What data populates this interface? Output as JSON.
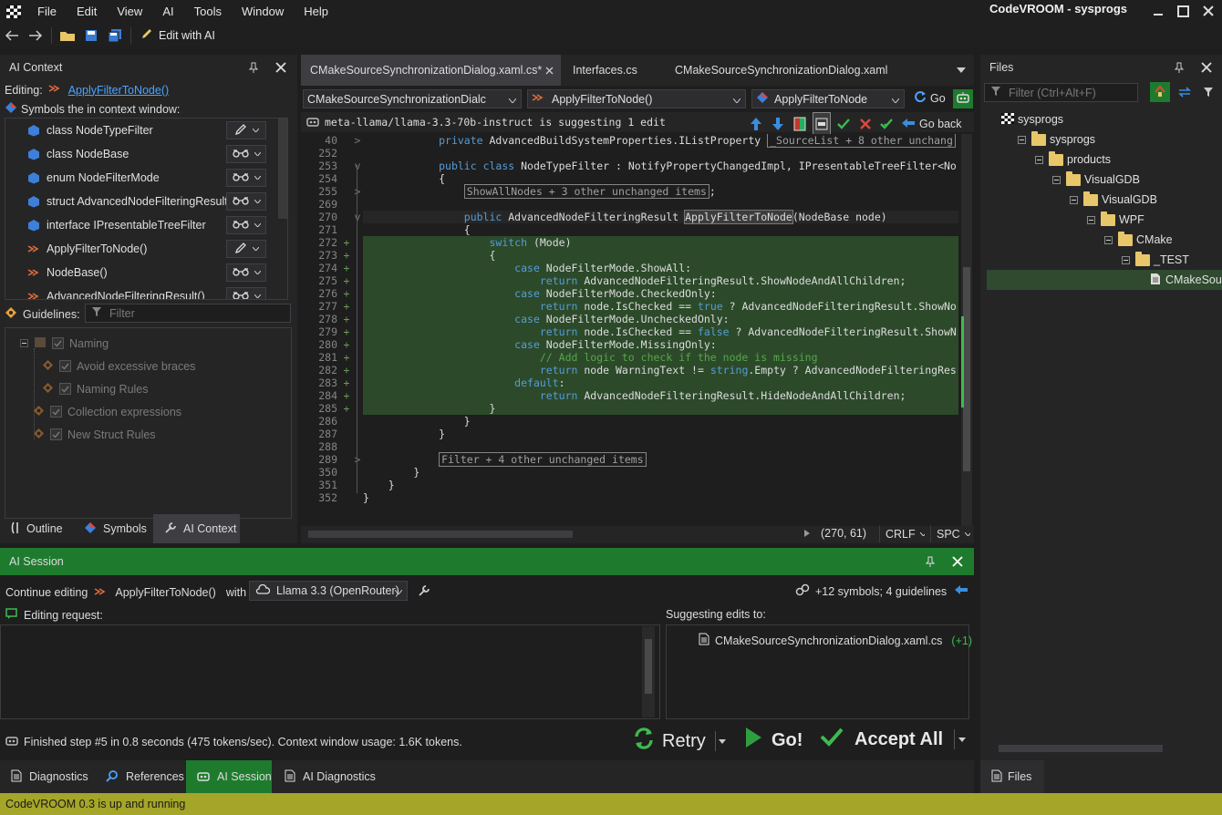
{
  "app": {
    "title": "CodeVROOM - sysprogs"
  },
  "menu": [
    "File",
    "Edit",
    "View",
    "AI",
    "Tools",
    "Window",
    "Help"
  ],
  "toolbar": {
    "edit_with_ai": "Edit with AI"
  },
  "ai_context": {
    "title": "AI Context",
    "editing_label": "Editing:",
    "editing_target": "ApplyFilterToNode()",
    "symbols_caption": "Symbols the in context window:",
    "symbols": [
      {
        "label": "class NodeTypeFilter",
        "mode": "edit-icon"
      },
      {
        "label": "class NodeBase",
        "mode": "glasses-icon"
      },
      {
        "label": "enum NodeFilterMode",
        "mode": "glasses-icon"
      },
      {
        "label": "struct AdvancedNodeFilteringResult",
        "mode": "glasses-icon"
      },
      {
        "label": "interface IPresentableTreeFilter",
        "mode": "glasses-icon"
      },
      {
        "label": "ApplyFilterToNode()",
        "mode": "edit-icon"
      },
      {
        "label": "NodeBase()",
        "mode": "glasses-icon"
      },
      {
        "label": "AdvancedNodeFilteringResult()",
        "mode": "glasses-icon"
      }
    ],
    "guidelines_label": "Guidelines:",
    "guidelines_filter_placeholder": "Filter",
    "guidelines": [
      {
        "label": "Naming",
        "level": 0
      },
      {
        "label": "Avoid excessive braces",
        "level": 1
      },
      {
        "label": "Naming Rules",
        "level": 1
      },
      {
        "label": "Collection expressions",
        "level": 0
      },
      {
        "label": "New Struct Rules",
        "level": 0
      }
    ],
    "tabs": [
      "Outline",
      "Symbols",
      "AI Context"
    ],
    "active_tab": "AI Context"
  },
  "editor": {
    "tabs": [
      {
        "label": "CMakeSourceSynchronizationDialog.xaml.cs*",
        "active": true
      },
      {
        "label": "Interfaces.cs",
        "active": false
      },
      {
        "label": "CMakeSourceSynchronizationDialog.xaml",
        "active": false
      }
    ],
    "nav": {
      "file": "CMakeSourceSynchronizationDialc",
      "member": "ApplyFilterToNode()",
      "symbol": "ApplyFilterToNode",
      "go": "Go"
    },
    "suggestion": {
      "text": "meta-llama/llama-3.3-70b-instruct is suggesting 1 edit",
      "go_back": "Go back"
    },
    "lines": [
      {
        "n": "40",
        "fold": ">",
        "added": false,
        "segs": [
          [
            "            ",
            ""
          ],
          [
            "private",
            "kw"
          ],
          [
            " AdvancedBuildSystemProperties.IListProperty ",
            ""
          ],
          [
            "_SourceList + 8 other unchang",
            "collapsed"
          ]
        ]
      },
      {
        "n": "252",
        "fold": "",
        "added": false,
        "segs": []
      },
      {
        "n": "253",
        "fold": "v",
        "added": false,
        "segs": [
          [
            "            ",
            ""
          ],
          [
            "public",
            "kw"
          ],
          [
            " ",
            ""
          ],
          [
            "class",
            "kw"
          ],
          [
            " NodeTypeFilter : NotifyPropertyChangedImpl, IPresentableTreeFilter<No",
            ""
          ]
        ]
      },
      {
        "n": "254",
        "fold": "",
        "added": false,
        "segs": [
          [
            "            {",
            ""
          ]
        ]
      },
      {
        "n": "255",
        "fold": ">",
        "added": false,
        "segs": [
          [
            "                ",
            ""
          ],
          [
            "ShowAllNodes + 3 other unchanged items",
            "collapsed"
          ],
          [
            ";",
            ""
          ]
        ]
      },
      {
        "n": "269",
        "fold": "",
        "added": false,
        "segs": []
      },
      {
        "n": "270",
        "fold": "v",
        "added": false,
        "segs": [
          [
            "                ",
            ""
          ],
          [
            "public",
            "kw"
          ],
          [
            " AdvancedNodeFilteringResult ",
            ""
          ],
          [
            "ApplyFilterToNode",
            "hl"
          ],
          [
            "(NodeBase node)",
            ""
          ]
        ]
      },
      {
        "n": "271",
        "fold": "",
        "added": false,
        "segs": [
          [
            "                {",
            ""
          ]
        ]
      },
      {
        "n": "272",
        "fold": "",
        "added": true,
        "segs": [
          [
            "                    ",
            ""
          ],
          [
            "switch",
            "kw"
          ],
          [
            " (Mode)",
            ""
          ]
        ]
      },
      {
        "n": "273",
        "fold": "",
        "added": true,
        "segs": [
          [
            "                    {",
            ""
          ]
        ]
      },
      {
        "n": "274",
        "fold": "",
        "added": true,
        "segs": [
          [
            "                        ",
            ""
          ],
          [
            "case",
            "kw"
          ],
          [
            " NodeFilterMode.ShowAll:",
            ""
          ]
        ]
      },
      {
        "n": "275",
        "fold": "",
        "added": true,
        "segs": [
          [
            "                            ",
            ""
          ],
          [
            "return",
            "kw"
          ],
          [
            " AdvancedNodeFilteringResult.ShowNodeAndAllChildren;",
            ""
          ]
        ]
      },
      {
        "n": "276",
        "fold": "",
        "added": true,
        "segs": [
          [
            "                        ",
            ""
          ],
          [
            "case",
            "kw"
          ],
          [
            " NodeFilterMode.CheckedOnly:",
            ""
          ]
        ]
      },
      {
        "n": "277",
        "fold": "",
        "added": true,
        "segs": [
          [
            "                            ",
            ""
          ],
          [
            "return",
            "kw"
          ],
          [
            " node.IsChecked == ",
            ""
          ],
          [
            "true",
            "kw"
          ],
          [
            " ? AdvancedNodeFilteringResult.ShowNo",
            ""
          ]
        ]
      },
      {
        "n": "278",
        "fold": "",
        "added": true,
        "segs": [
          [
            "                        ",
            ""
          ],
          [
            "case",
            "kw"
          ],
          [
            " NodeFilterMode.UncheckedOnly:",
            ""
          ]
        ]
      },
      {
        "n": "279",
        "fold": "",
        "added": true,
        "segs": [
          [
            "                            ",
            ""
          ],
          [
            "return",
            "kw"
          ],
          [
            " node.IsChecked == ",
            ""
          ],
          [
            "false",
            "kw"
          ],
          [
            " ? AdvancedNodeFilteringResult.ShowN",
            ""
          ]
        ]
      },
      {
        "n": "280",
        "fold": "",
        "added": true,
        "segs": [
          [
            "                        ",
            ""
          ],
          [
            "case",
            "kw"
          ],
          [
            " NodeFilterMode.MissingOnly:",
            ""
          ]
        ]
      },
      {
        "n": "281",
        "fold": "",
        "added": true,
        "segs": [
          [
            "                            ",
            ""
          ],
          [
            "// Add logic to check if the node is missing",
            "cm"
          ]
        ]
      },
      {
        "n": "282",
        "fold": "",
        "added": true,
        "segs": [
          [
            "                            ",
            ""
          ],
          [
            "return",
            "kw"
          ],
          [
            " node WarningText != ",
            ""
          ],
          [
            "string",
            "kw"
          ],
          [
            ".Empty ? AdvancedNodeFilteringRes",
            ""
          ]
        ]
      },
      {
        "n": "283",
        "fold": "",
        "added": true,
        "segs": [
          [
            "                        ",
            ""
          ],
          [
            "default",
            "kw"
          ],
          [
            ":",
            ""
          ]
        ]
      },
      {
        "n": "284",
        "fold": "",
        "added": true,
        "segs": [
          [
            "                            ",
            ""
          ],
          [
            "return",
            "kw"
          ],
          [
            " AdvancedNodeFilteringResult.HideNodeAndAllChildren;",
            ""
          ]
        ]
      },
      {
        "n": "285",
        "fold": "",
        "added": true,
        "segs": [
          [
            "                    }",
            ""
          ]
        ]
      },
      {
        "n": "286",
        "fold": "",
        "added": false,
        "segs": [
          [
            "                }",
            ""
          ]
        ]
      },
      {
        "n": "287",
        "fold": "",
        "added": false,
        "segs": [
          [
            "            }",
            ""
          ]
        ]
      },
      {
        "n": "288",
        "fold": "",
        "added": false,
        "segs": []
      },
      {
        "n": "289",
        "fold": ">",
        "added": false,
        "segs": [
          [
            "            ",
            ""
          ],
          [
            "Filter + 4 other unchanged items",
            "collapsed"
          ]
        ]
      },
      {
        "n": "350",
        "fold": "",
        "added": false,
        "segs": [
          [
            "        }",
            ""
          ]
        ]
      },
      {
        "n": "351",
        "fold": "",
        "added": false,
        "segs": [
          [
            "    }",
            ""
          ]
        ]
      },
      {
        "n": "352",
        "fold": "",
        "added": false,
        "segs": [
          [
            "}",
            ""
          ]
        ]
      }
    ],
    "status": {
      "position": "(270, 61)",
      "eol": "CRLF",
      "indent": "SPC"
    }
  },
  "files": {
    "title": "Files",
    "filter_placeholder": "Filter (Ctrl+Alt+F)",
    "tree": [
      {
        "label": "sysprogs",
        "level": 0,
        "type": "root"
      },
      {
        "label": "sysprogs",
        "level": 1,
        "type": "folder"
      },
      {
        "label": "products",
        "level": 2,
        "type": "folder"
      },
      {
        "label": "VisualGDB",
        "level": 3,
        "type": "folder"
      },
      {
        "label": "VisualGDB",
        "level": 4,
        "type": "folder"
      },
      {
        "label": "WPF",
        "level": 5,
        "type": "folder"
      },
      {
        "label": "CMake",
        "level": 6,
        "type": "folder"
      },
      {
        "label": "_TEST",
        "level": 7,
        "type": "folder"
      },
      {
        "label": "CMakeSour",
        "level": 8,
        "type": "file"
      }
    ],
    "tab": "Files"
  },
  "session": {
    "title": "AI Session",
    "continue_label": "Continue editing",
    "continue_target": "ApplyFilterToNode()",
    "with_label": "with",
    "model": "Llama 3.3 (OpenRouter)",
    "context_summary": "+12 symbols; 4 guidelines",
    "request_label": "Editing request:",
    "suggesting_label": "Suggesting edits to:",
    "suggest_file": "CMakeSourceSynchronizationDialog.xaml.cs",
    "suggest_count": "(+1)",
    "status_text": "Finished step #5 in 0.8 seconds (475 tokens/sec). Context window usage: 1.6K tokens.",
    "retry": "Retry",
    "go": "Go!",
    "accept_all": "Accept All"
  },
  "bottom_tabs": [
    "Diagnostics",
    "References",
    "AI Session",
    "AI Diagnostics"
  ],
  "active_bottom_tab": "AI Session",
  "statusbar": {
    "text": "CodeVROOM 0.3 is up and running"
  },
  "colors": {
    "accent_green": "#1e7b2e",
    "status_olive": "#a5a529",
    "diff_add": "#2c4a2a",
    "keyword": "#569cd6",
    "comment": "#57a64a"
  }
}
